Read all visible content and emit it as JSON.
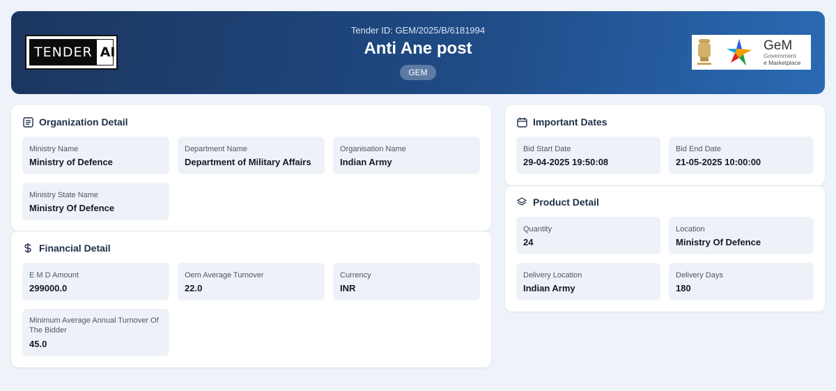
{
  "header": {
    "logo_left": {
      "dark": "TENDER",
      "light": "AI"
    },
    "tender_id": "Tender ID: GEM/2025/B/6181994",
    "title": "Anti Ane post",
    "badge": "GEM",
    "logo_right": {
      "name": "GeM",
      "line1": "Government",
      "line2": "e Marketplace"
    }
  },
  "organization": {
    "title": "Organization Detail",
    "fields": [
      {
        "label": "Ministry Name",
        "value": "Ministry of Defence"
      },
      {
        "label": "Department Name",
        "value": "Department of Military Affairs"
      },
      {
        "label": "Organisation Name",
        "value": "Indian Army"
      },
      {
        "label": "Ministry State Name",
        "value": "Ministry Of Defence"
      }
    ]
  },
  "financial": {
    "title": "Financial Detail",
    "fields": [
      {
        "label": "E M D Amount",
        "value": "299000.0"
      },
      {
        "label": "Oem Average Turnover",
        "value": "22.0"
      },
      {
        "label": "Currency",
        "value": "INR"
      },
      {
        "label": "Minimum Average Annual Turnover Of The Bidder",
        "value": "45.0"
      }
    ]
  },
  "dates": {
    "title": "Important Dates",
    "fields": [
      {
        "label": "Bid Start Date",
        "value": "29-04-2025 19:50:08"
      },
      {
        "label": "Bid End Date",
        "value": "21-05-2025 10:00:00"
      }
    ]
  },
  "product": {
    "title": "Product Detail",
    "fields": [
      {
        "label": "Quantity",
        "value": "24"
      },
      {
        "label": "Location",
        "value": "Ministry Of Defence"
      },
      {
        "label": "Delivery Location",
        "value": "Indian Army"
      },
      {
        "label": "Delivery Days",
        "value": "180"
      }
    ]
  },
  "colors": {
    "header_start": "#1b365f",
    "header_end": "#2a6ab4",
    "page_bg": "#eef2f9",
    "field_bg": "#eef2f8"
  }
}
